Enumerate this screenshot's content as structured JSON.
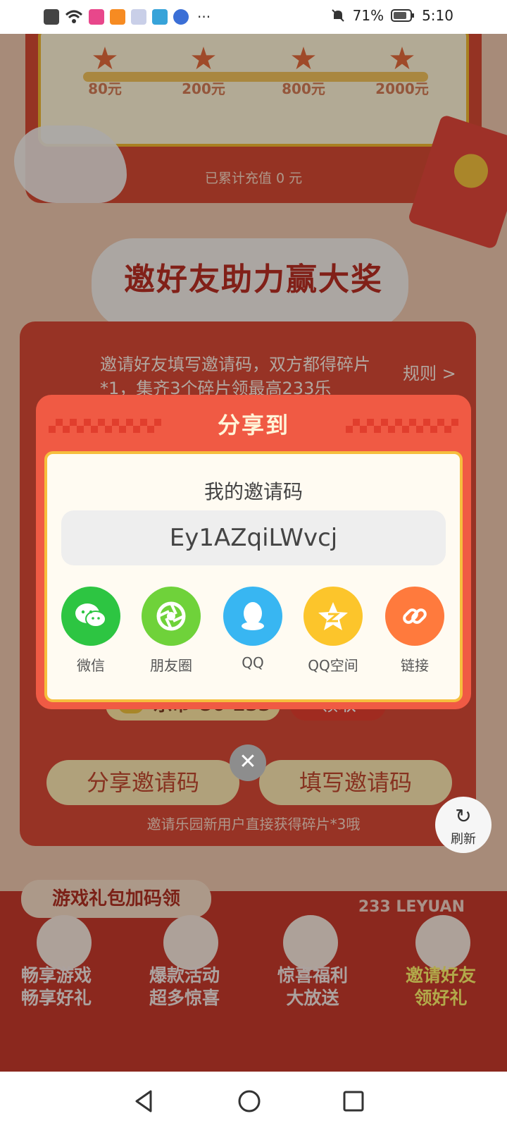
{
  "status_bar": {
    "battery": "71%",
    "time": "5:10",
    "more": "···"
  },
  "recharge": {
    "milestones": [
      "80元",
      "200元",
      "800元",
      "2000元"
    ],
    "cumulative_text": "已累计充值 0 元"
  },
  "section_title": "邀好友助力赢大奖",
  "invite": {
    "hint": "邀请好友填写邀请码，双方都得碎片*1，集齐3个碎片领最高233乐",
    "rules_link": "规则 >",
    "reward_text": "乐币*50-233",
    "claim_label": "领取",
    "share_code_button": "分享邀请码",
    "fill_code_button": "填写邀请码",
    "sub_hint": "邀请乐园新用户直接获得碎片*3哦"
  },
  "refresh_label": "刷新",
  "gift_banner": "游戏礼包加码领",
  "brand_text": "233 LEYUAN",
  "bottom_features": [
    {
      "line1": "畅享游戏",
      "line2": "畅享好礼"
    },
    {
      "line1": "爆款活动",
      "line2": "超多惊喜"
    },
    {
      "line1": "惊喜福利",
      "line2": "大放送"
    },
    {
      "line1": "邀请好友",
      "line2": "领好礼"
    }
  ],
  "share_dialog": {
    "title": "分享到",
    "code_label": "我的邀请码",
    "code": "Ey1AZqiLWvcj",
    "targets": [
      {
        "label": "微信",
        "icon": "wechat-icon",
        "color": "#2dc542"
      },
      {
        "label": "朋友圈",
        "icon": "moments-icon",
        "color": "#6fd23a"
      },
      {
        "label": "QQ",
        "icon": "qq-icon",
        "color": "#38b6f2"
      },
      {
        "label": "QQ空间",
        "icon": "qzone-icon",
        "color": "#fcc52b"
      },
      {
        "label": "链接",
        "icon": "link-icon",
        "color": "#ff7a3d"
      }
    ],
    "close_symbol": "✕"
  },
  "colors": {
    "dialog_header": "#f05a44",
    "dialog_border": "#f6be3d",
    "page_red": "#d94a35"
  }
}
